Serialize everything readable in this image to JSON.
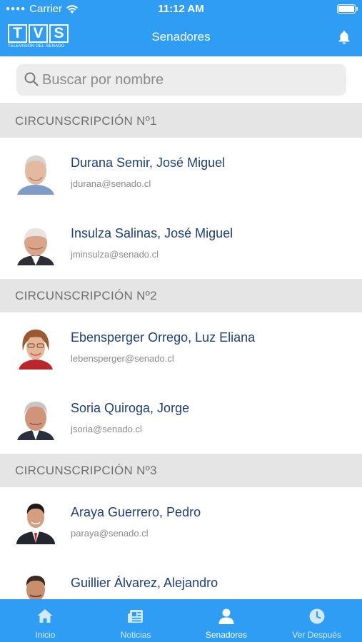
{
  "status_bar": {
    "carrier": "Carrier",
    "time": "11:12 AM"
  },
  "header": {
    "logo_letters": [
      "T",
      "V",
      "S"
    ],
    "logo_subtitle": "TELEVISIÓN DEL SENADO",
    "title": "Senadores"
  },
  "search": {
    "placeholder": "Buscar por nombre",
    "value": ""
  },
  "sections": [
    {
      "title": "CIRCUNSCRIPCIÓN Nº1",
      "senators": [
        {
          "name": "Durana Semir, José Miguel",
          "email": "jdurana@senado.cl"
        },
        {
          "name": "Insulza Salinas, José Miguel",
          "email": "jminsulza@senado.cl"
        }
      ]
    },
    {
      "title": "CIRCUNSCRIPCIÓN Nº2",
      "senators": [
        {
          "name": "Ebensperger Orrego, Luz Eliana",
          "email": "lebensperger@senado.cl"
        },
        {
          "name": "Soria Quiroga, Jorge",
          "email": "jsoria@senado.cl"
        }
      ]
    },
    {
      "title": "CIRCUNSCRIPCIÓN Nº3",
      "senators": [
        {
          "name": "Araya Guerrero, Pedro",
          "email": "paraya@senado.cl"
        },
        {
          "name": "Guillier Álvarez, Alejandro",
          "email": ""
        }
      ]
    }
  ],
  "tabbar": {
    "tabs": [
      {
        "label": "Inicio",
        "icon": "home-icon"
      },
      {
        "label": "Noticias",
        "icon": "news-icon"
      },
      {
        "label": "Senadores",
        "icon": "person-icon",
        "active": true
      },
      {
        "label": "Ver Después",
        "icon": "clock-icon"
      }
    ]
  },
  "colors": {
    "brand_blue": "#2f9df4",
    "name_text": "#1e3f73",
    "section_bg": "#e5e5e5"
  }
}
